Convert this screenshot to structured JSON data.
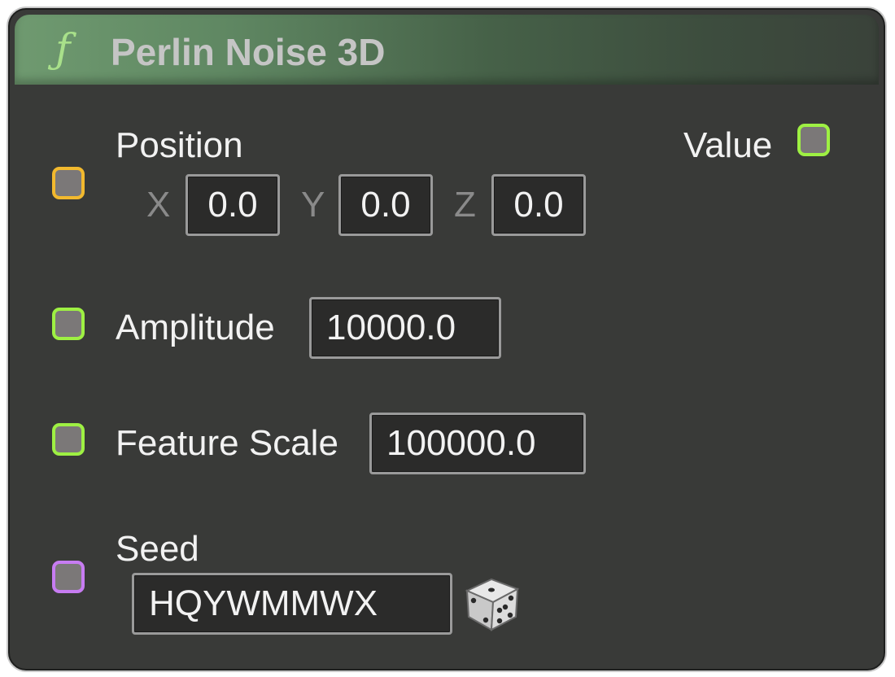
{
  "node": {
    "title": "Perlin Noise 3D",
    "function_icon": "function-icon"
  },
  "inputs": {
    "position": {
      "label": "Position",
      "pin_color": "#f2b92e",
      "axes": [
        {
          "axis": "X",
          "value": "0.0"
        },
        {
          "axis": "Y",
          "value": "0.0"
        },
        {
          "axis": "Z",
          "value": "0.0"
        }
      ]
    },
    "amplitude": {
      "label": "Amplitude",
      "value": "10000.0",
      "pin_color": "#9ef043"
    },
    "feature_scale": {
      "label": "Feature Scale",
      "value": "100000.0",
      "pin_color": "#9ef043"
    },
    "seed": {
      "label": "Seed",
      "value": "HQYWMMWX",
      "pin_color": "#c77cf2",
      "randomize_icon": "dice-icon"
    }
  },
  "outputs": {
    "value": {
      "label": "Value",
      "pin_color": "#9ef043"
    }
  }
}
